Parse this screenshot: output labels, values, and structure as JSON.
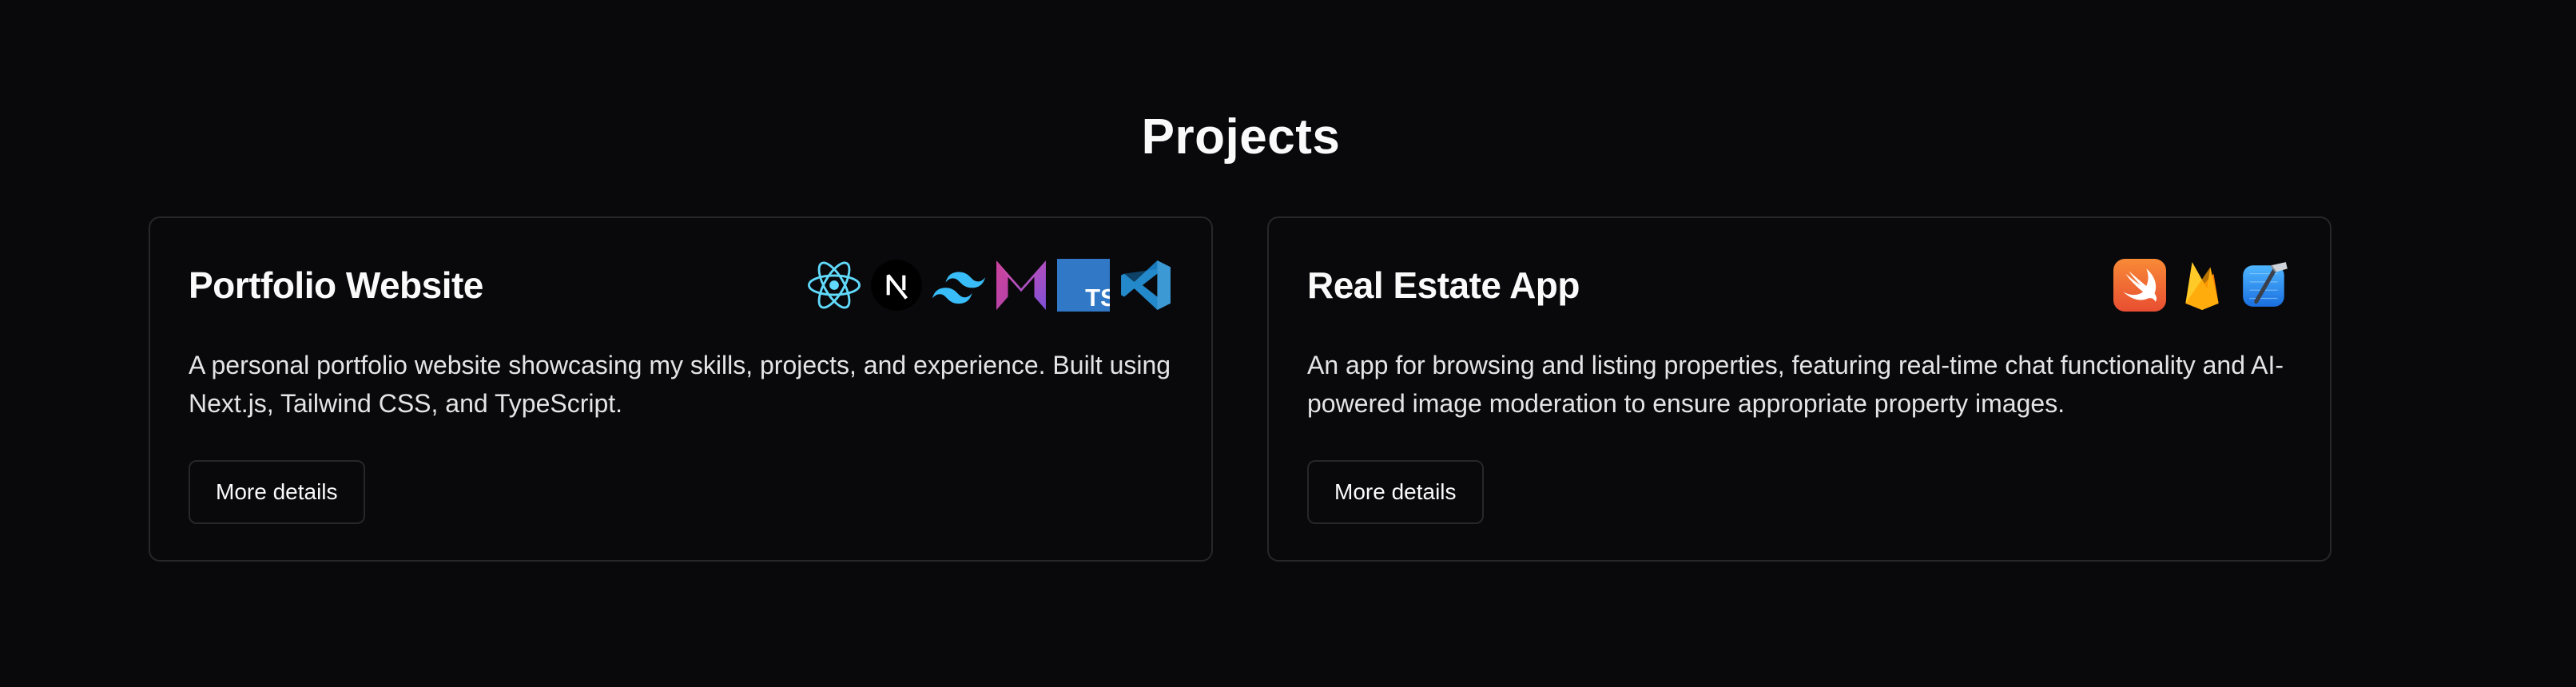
{
  "section": {
    "title": "Projects"
  },
  "projects": [
    {
      "title": "Portfolio Website",
      "description": "A personal portfolio website showcasing my skills, projects, and experience. Built using Next.js, Tailwind CSS, and TypeScript.",
      "button_label": "More details",
      "tech_icons": [
        "react-icon",
        "nextjs-icon",
        "tailwind-icon",
        "framer-motion-icon",
        "typescript-icon",
        "vscode-icon"
      ]
    },
    {
      "title": "Real Estate App",
      "description": "An app for browsing and listing properties, featuring real-time chat functionality and AI-powered image moderation to ensure appropriate property images.",
      "button_label": "More details",
      "tech_icons": [
        "swift-icon",
        "firebase-icon",
        "xcode-icon"
      ]
    }
  ],
  "colors": {
    "background": "#09090b",
    "card_border": "#27272a",
    "text": "#fafafa",
    "react": "#61dafb",
    "tailwind": "#38bdf8",
    "typescript": "#3178c6",
    "vscode": "#2489ca",
    "swift": "#f05138",
    "firebase": "#ffca28",
    "xcode": "#1f8ff5"
  }
}
